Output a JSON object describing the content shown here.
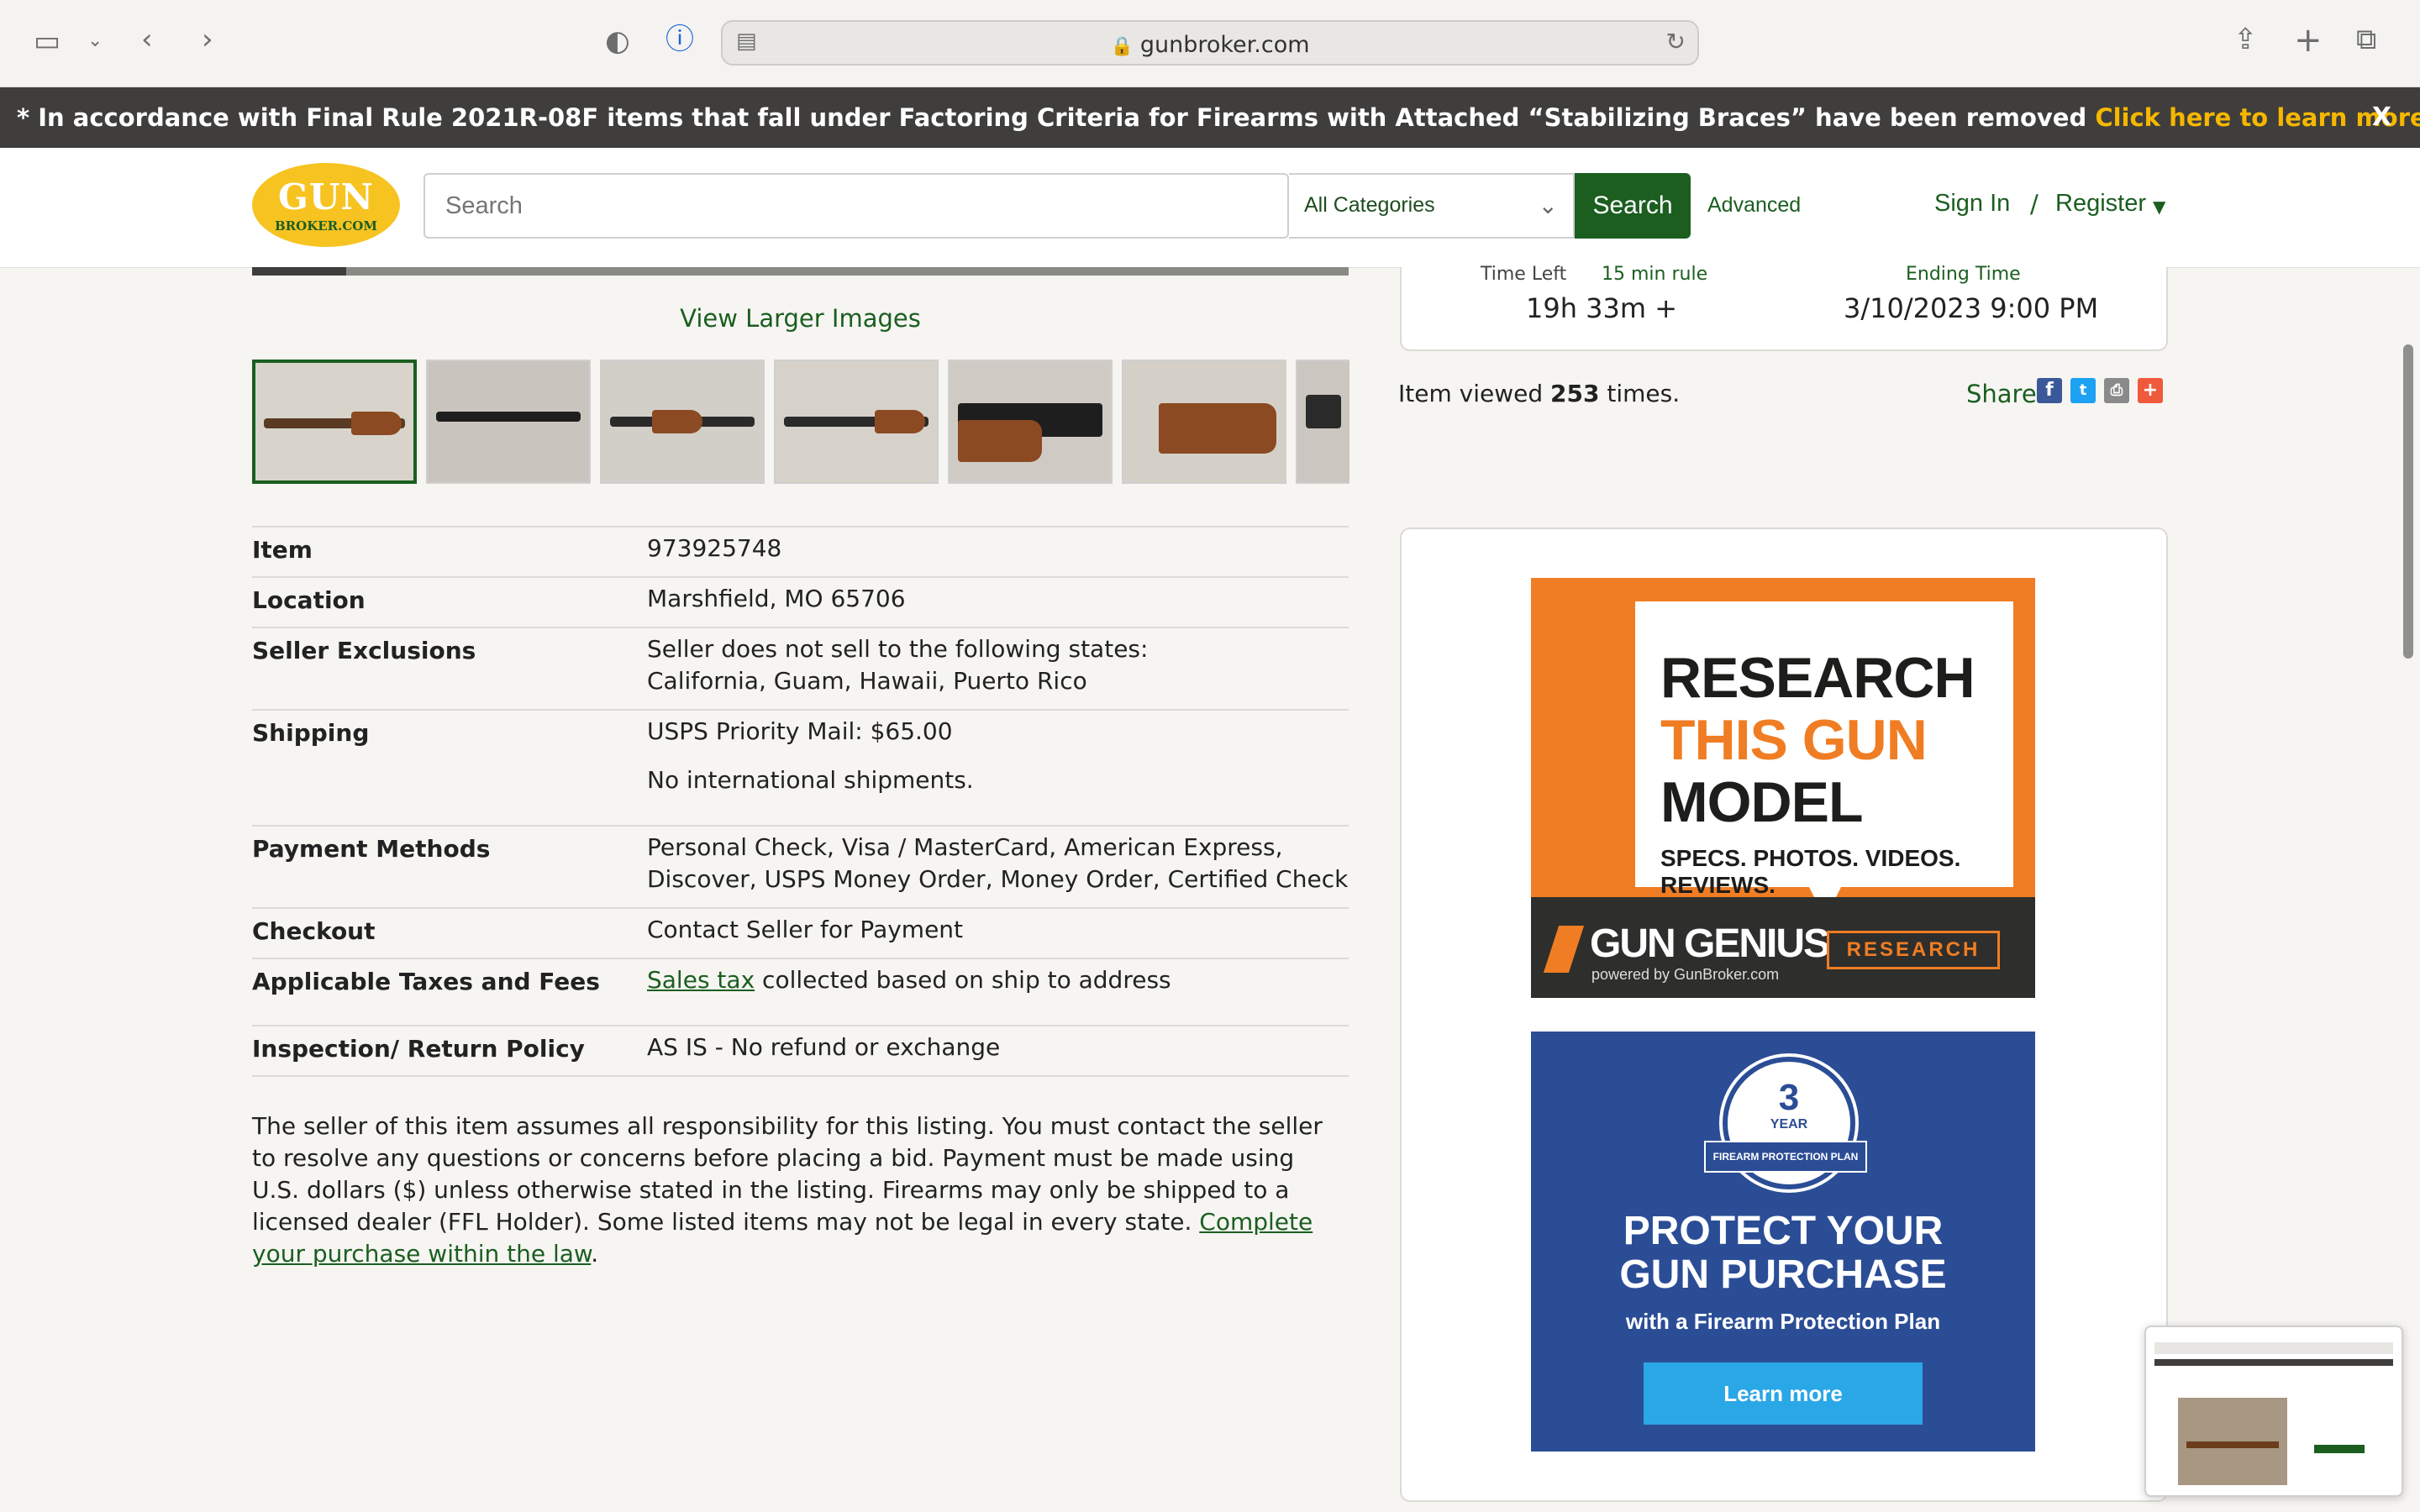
{
  "browser": {
    "url": "gunbroker.com"
  },
  "notice": {
    "text": "* In accordance with Final Rule 2021R-08F items that fall under Factoring Criteria for Firearms with Attached “Stabilizing Braces” have been removed",
    "link": "Click here to learn more.",
    "suffix": "*",
    "close": "X"
  },
  "header": {
    "logo_top": "GUN",
    "logo_sub": "BROKER.COM",
    "search_placeholder": "Search",
    "category": "All Categories",
    "search_button": "Search",
    "advanced": "Advanced",
    "sign_in": "Sign In",
    "separator": "/",
    "register": "Register"
  },
  "gallery": {
    "view_larger": "View Larger Images",
    "thumb_count": 7
  },
  "auction": {
    "time_left_label": "Time Left",
    "rule_label": "15 min rule",
    "ending_label": "Ending Time",
    "time_left": "19h 33m +",
    "ending_time": "3/10/2023 9:00 PM",
    "views_prefix": "Item viewed",
    "views_count": "253",
    "views_suffix": "times.",
    "share_label": "Share"
  },
  "details": [
    {
      "label": "Item",
      "value": "973925748"
    },
    {
      "label": "Location",
      "value": "Marshfield, MO 65706"
    },
    {
      "label": "Seller Exclusions",
      "value": "Seller does not sell to the following states:",
      "value2": "California, Guam, Hawaii, Puerto Rico"
    },
    {
      "label": "Shipping",
      "value": "USPS Priority Mail: $65.00",
      "value2": "No international shipments."
    },
    {
      "label": "Payment Methods",
      "value": "Personal Check, Visa / MasterCard, American Express,",
      "value2": "Discover, USPS Money Order, Money Order, Certified Check"
    },
    {
      "label": "Checkout",
      "value": "Contact Seller for Payment"
    },
    {
      "label": "Applicable Taxes and Fees",
      "link": "Sales tax",
      "value": "collected based on ship to address"
    },
    {
      "label": "Inspection/ Return Policy",
      "value": "AS IS - No refund or exchange"
    }
  ],
  "disclaimer": {
    "text": "The seller of this item assumes all responsibility for this listing. You must contact the seller to resolve any questions or concerns before placing a bid. Payment must be made using U.S. dollars ($) unless otherwise stated in the listing. Firearms may only be shipped to a licensed dealer (FFL Holder). Some listed items may not be legal in every state.",
    "link": "Complete your purchase within the law",
    "end": "."
  },
  "ad1": {
    "line1": "RESEARCH",
    "line2": "THIS GUN",
    "line3": "MODEL",
    "sub": "SPECS. PHOTOS. VIDEOS. REVIEWS.",
    "brand": "GUN GENIUS",
    "powered": "powered by GunBroker.com",
    "button": "RESEARCH"
  },
  "ad2": {
    "badge_num": "3",
    "badge_year": "YEAR",
    "badge_ribbon": "FIREARM PROTECTION PLAN",
    "headline1": "PROTECT YOUR",
    "headline2": "GUN PURCHASE",
    "sub": "with a Firearm Protection Plan",
    "button": "Learn more"
  },
  "colors": {
    "brand_green": "#1b5e20",
    "notice_link": "#f5b700",
    "logo_yellow": "#f7c321",
    "ad_orange": "#f07d23",
    "ad_blue": "#2b4d96"
  }
}
